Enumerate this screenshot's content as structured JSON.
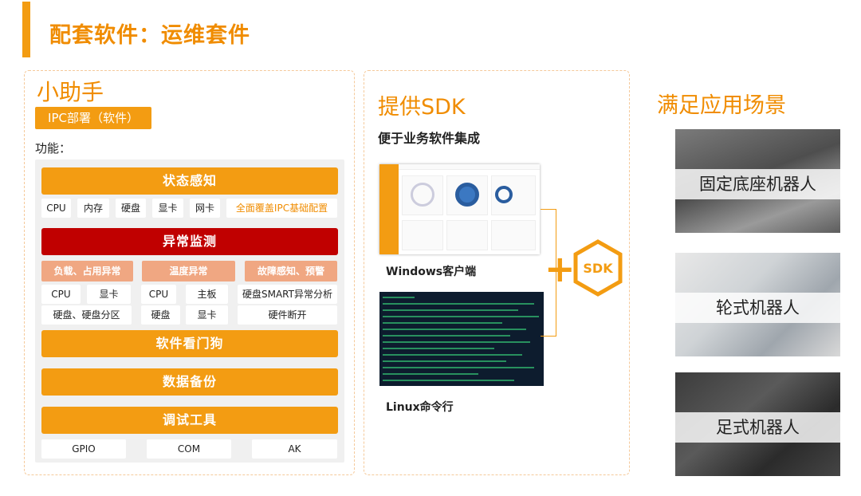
{
  "title": "配套软件：运维套件",
  "left": {
    "title": "小助手",
    "badge": "IPC部署（软件）",
    "func_label": "功能：",
    "status": {
      "bar": "状态感知",
      "chips": [
        "CPU",
        "内存",
        "硬盘",
        "显卡",
        "网卡"
      ],
      "highlight": "全面覆盖IPC基础配置"
    },
    "anomaly": {
      "bar": "异常监测",
      "categories": [
        "负载、占用异常",
        "温度异常",
        "故障感知、预警"
      ],
      "row1": [
        "CPU",
        "显卡",
        "CPU",
        "主板",
        "硬盘SMART异常分析"
      ],
      "row2": [
        "硬盘、硬盘分区",
        "硬盘",
        "显卡",
        "硬件断开"
      ]
    },
    "watchdog": "软件看门狗",
    "backup": "数据备份",
    "debug": {
      "bar": "调试工具",
      "chips": [
        "GPIO",
        "COM",
        "AK"
      ]
    }
  },
  "middle": {
    "title": "提供SDK",
    "subtitle": "便于业务软件集成",
    "windows_label": "Windows客户端",
    "linux_label": "Linux命令行",
    "sdk_text": "SDK"
  },
  "right": {
    "title": "满足应用场景",
    "scenes": [
      "固定底座机器人",
      "轮式机器人",
      "足式机器人"
    ]
  },
  "colors": {
    "accent": "#f39c12",
    "title_orange": "#f08c00",
    "alert_red": "#c00000",
    "peach": "#f0a782"
  }
}
